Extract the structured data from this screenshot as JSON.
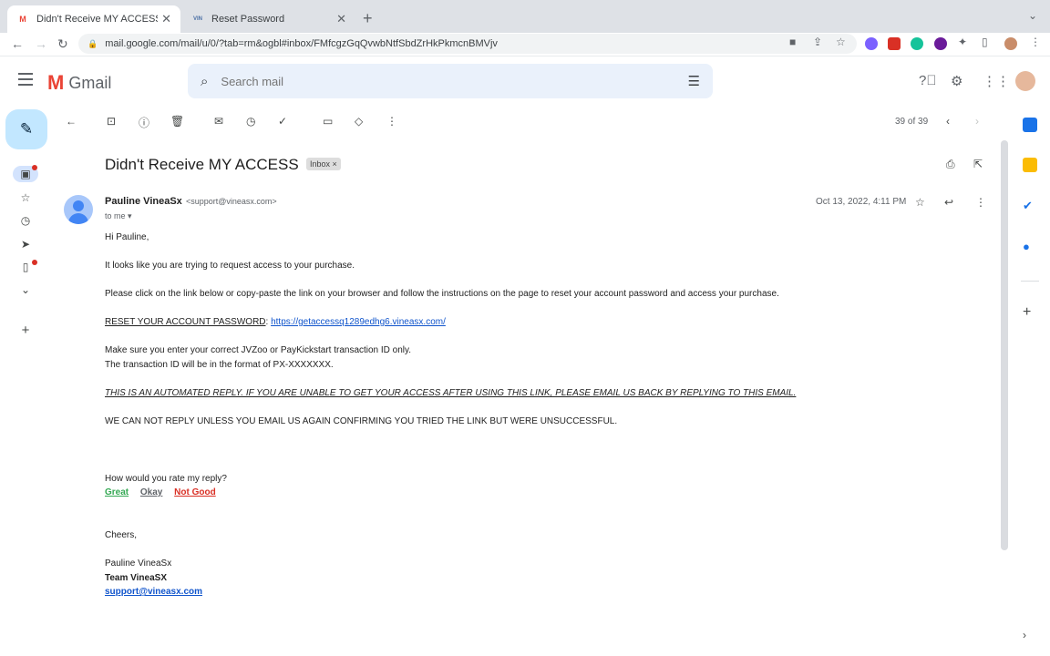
{
  "browser": {
    "tabs": [
      {
        "title": "Didn't Receive MY ACCESS - p",
        "favicon": "M"
      },
      {
        "title": "Reset Password",
        "favicon": "VIN"
      }
    ],
    "url": "mail.google.com/mail/u/0/?tab=rm&ogbl#inbox/FMfcgzGqQvwbNtfSbdZrHkPkmcnBMVjv"
  },
  "gmail": {
    "product": "Gmail",
    "search_placeholder": "Search mail"
  },
  "thread": {
    "counter": "39 of 39",
    "subject": "Didn't Receive MY ACCESS",
    "label": "Inbox",
    "label_remove": "×",
    "sender_name": "Pauline VineaSx",
    "sender_email": "<support@vineasx.com>",
    "to": "to me",
    "date": "Oct 13, 2022, 4:11 PM"
  },
  "body": {
    "greeting": "Hi Pauline,",
    "p1": "It looks like you are trying to request access to your purchase.",
    "p2": "Please click on the link below or copy-paste the link on your browser and follow the instructions on the page to reset your account password and access your purchase.",
    "reset_label": "RESET YOUR ACCOUNT PASSWORD",
    "reset_sep": ":",
    "reset_link": "https://getaccessq1289edhg6.vineasx.com/",
    "p3a": "Make sure you enter your correct JVZoo or PayKickstart transaction ID only.",
    "p3b": "The transaction ID will be in the format of PX-XXXXXXX.",
    "p4": "THIS IS AN AUTOMATED REPLY. IF YOU ARE UNABLE TO GET YOUR ACCESS AFTER USING THIS LINK, PLEASE EMAIL US BACK BY REPLYING TO THIS EMAIL.",
    "p5": "WE CAN NOT REPLY UNLESS YOU EMAIL US AGAIN CONFIRMING YOU TRIED THE LINK BUT WERE UNSUCCESSFUL.",
    "rate_q": "How would you rate my reply?",
    "rate_great": "Great",
    "rate_okay": "Okay",
    "rate_bad": "Not Good",
    "cheers": "Cheers,",
    "sig_name": "Pauline VineaSx",
    "sig_team": "Team VineaSX",
    "sig_email": "support@vineasx.com"
  },
  "colors": {
    "compose_bg": "#c2e7ff",
    "great": "#34a853",
    "okay": "#5f6368",
    "bad": "#d93025",
    "link": "#1155cc"
  }
}
